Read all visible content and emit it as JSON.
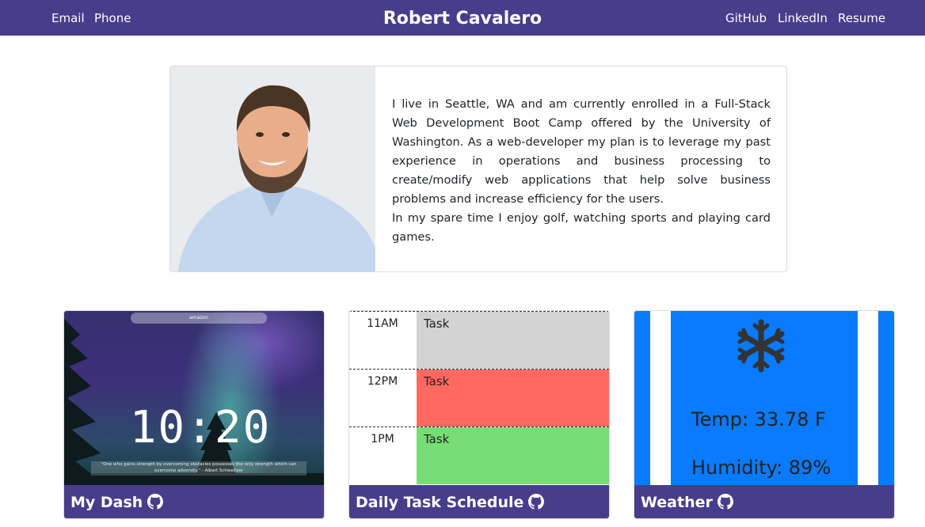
{
  "nav": {
    "brand": "Robert Cavalero",
    "left_links": [
      "Email",
      "Phone"
    ],
    "right_links": [
      "GitHub",
      "LinkedIn",
      "Resume"
    ]
  },
  "about": {
    "paragraph1": "I live in Seattle, WA and am currently enrolled in a Full-Stack Web Development Boot Camp offered by the University of Washington. As a web-developer my plan is to leverage my past experience in operations and business processing to create/modify web applications that help solve business problems and increase efficiency for the users.",
    "paragraph2": "In my spare time I enjoy golf, watching sports and playing card games."
  },
  "projects": [
    {
      "title": "My Dash",
      "icon": "github-icon",
      "preview": {
        "search_text": "amazon",
        "time": "10:20",
        "quote": "\"One who gains strength by overcoming obstacles possesses the only strength which can overcome adversity.\" - Albert Schweitzer"
      }
    },
    {
      "title": "Daily Task Schedule",
      "icon": "github-icon",
      "preview": {
        "rows": [
          {
            "hour": "11AM",
            "task": "Task",
            "color": "#d3d3d3"
          },
          {
            "hour": "12PM",
            "task": "Task",
            "color": "#ff6961"
          },
          {
            "hour": "1PM",
            "task": "Task",
            "color": "#77dd77"
          }
        ]
      }
    },
    {
      "title": "Weather",
      "icon": "github-icon",
      "preview": {
        "weather_icon": "snowflake-icon",
        "temp": "Temp: 33.78 F",
        "humidity": "Humidity: 89%"
      }
    }
  ],
  "colors": {
    "navbar": "#483d8b",
    "weather_bg": "#0a7aff"
  }
}
